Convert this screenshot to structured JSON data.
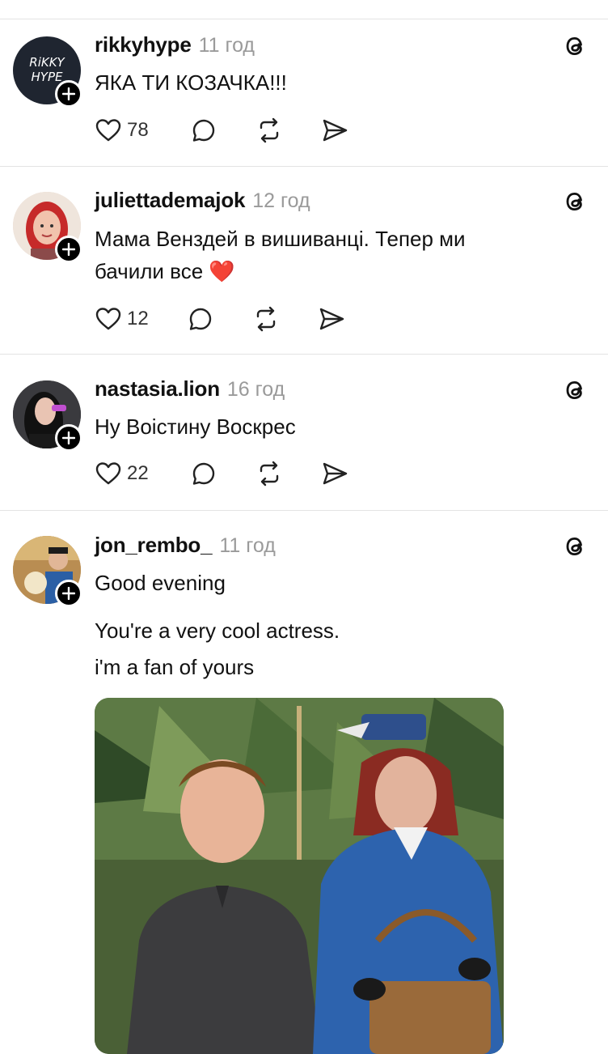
{
  "posts": [
    {
      "username": "rikkyhype",
      "time": "11 год",
      "lines": [
        "ЯКА ТИ КОЗАЧКА!!!"
      ],
      "likes": "78",
      "avatar_text": "RIKKY HYPE"
    },
    {
      "username": "juliettademajok",
      "time": "12 год",
      "lines": [
        "Мама Венздей в вишиванці. Тепер ми",
        "бачили все ❤️"
      ],
      "likes": "12"
    },
    {
      "username": "nastasia.lion",
      "time": "16 год",
      "lines": [
        "Ну Воістину Воскрес"
      ],
      "likes": "22"
    },
    {
      "username": "jon_rembo_",
      "time": "11 год",
      "lines": [
        "Good evening",
        "You're a very cool actress.",
        "i'm a fan of yours"
      ],
      "likes": ""
    }
  ],
  "icons": {
    "like": "heart-icon",
    "reply": "comment-icon",
    "repost": "repost-icon",
    "share": "send-icon",
    "threads": "threads-logo-icon",
    "follow": "plus-icon"
  },
  "colors": {
    "divider": "#e3e3e3",
    "timestamp": "#9a9a9a",
    "heart": "#e0162b"
  }
}
